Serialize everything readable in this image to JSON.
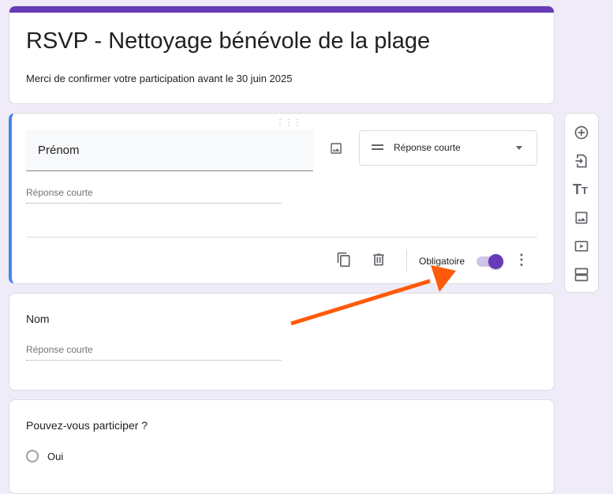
{
  "header": {
    "title": "RSVP - Nettoyage bénévole de la plage",
    "description": "Merci de confirmer votre participation avant le 30 juin 2025"
  },
  "questions": [
    {
      "title": "Prénom",
      "type_label": "Réponse courte",
      "answer_placeholder": "Réponse courte",
      "required_label": "Obligatoire",
      "required": true
    },
    {
      "title": "Nom",
      "answer_placeholder": "Réponse courte"
    },
    {
      "title": "Pouvez-vous participer ?",
      "options": [
        "Oui"
      ]
    }
  ],
  "colors": {
    "accent": "#673ab7",
    "active_border": "#4285f4",
    "annotation_arrow": "#ff5a0a"
  }
}
